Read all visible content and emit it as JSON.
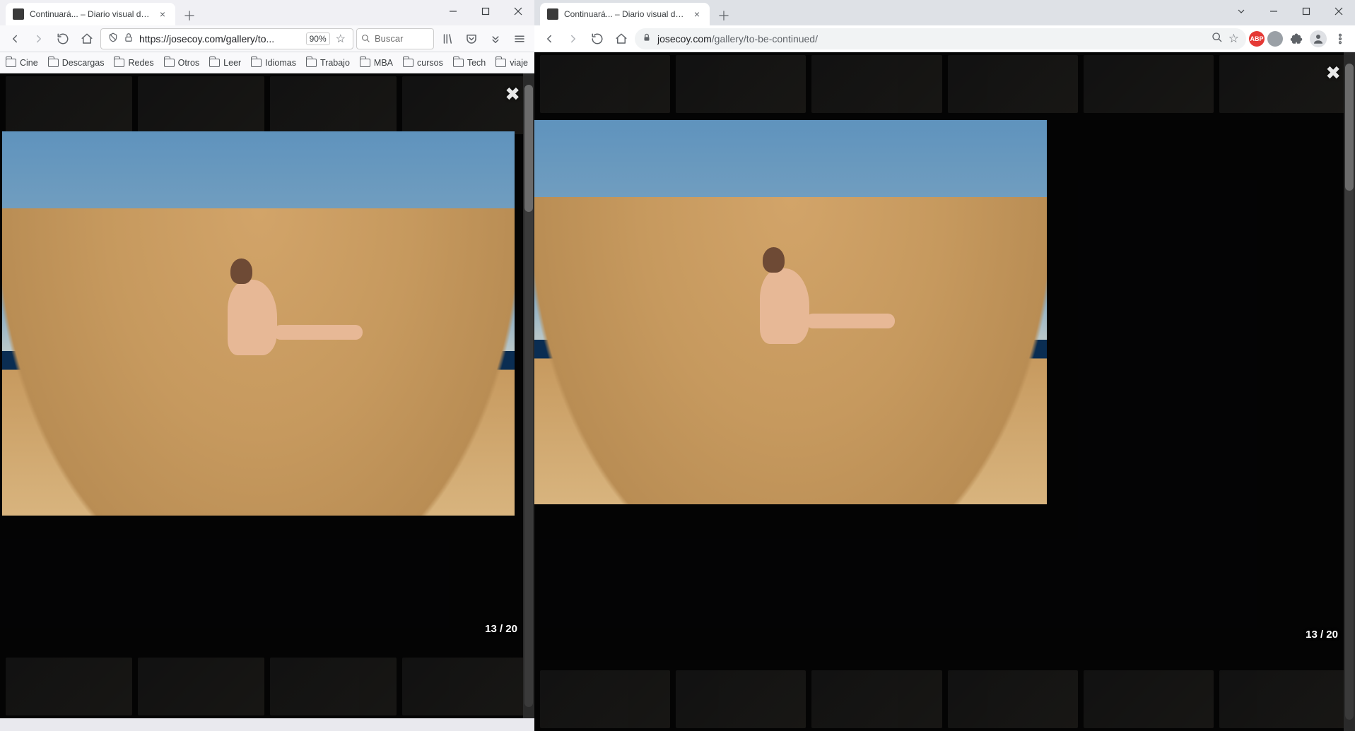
{
  "left": {
    "tab_title": "Continuará... – Diario visual de ...",
    "url_display": "https://josecoy.com/gallery/to...",
    "zoom": "90%",
    "search_placeholder": "Buscar",
    "bookmarks": [
      "Cine",
      "Descargas",
      "Redes",
      "Otros",
      "Leer",
      "Idiomas",
      "Trabajo",
      "MBA",
      "cursos",
      "Tech",
      "viaje"
    ],
    "counter": "13 / 20"
  },
  "right": {
    "tab_title": "Continuará... – Diario visual de Jo...",
    "url_host": "josecoy.com",
    "url_path": "/gallery/to-be-continued/",
    "ext_badge": "ABP",
    "counter": "13 / 20"
  }
}
